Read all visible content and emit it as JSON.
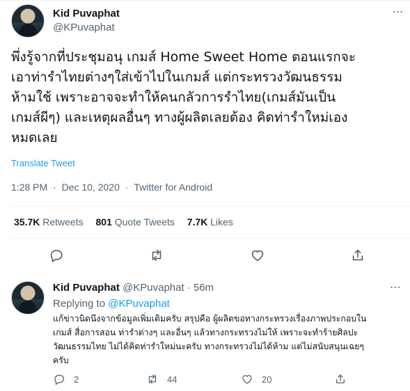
{
  "tweet": {
    "author": {
      "display_name": "Kid Puvaphat",
      "handle": "@KPuvaphat"
    },
    "text_lines": [
      "พึ่งรู้จากที่ประชุมอนุ เกมส์ Home Sweet Home ตอนแรกจะ",
      "เอาท่ารำไทยต่างๆใส่เข้าไปในเกมส์ แต่กระทรวงวัฒนธรรม",
      "ห้ามใช้ เพราะอาจจะทำให้คนกลัวการรำไทย(เกมส์มันเป็น",
      "เกมส์ผีๆ) และเหตุผลอื่นๆ ทางผู้ผลิตเลยต้อง คิดท่ารำใหม่เอง",
      "หมดเลย"
    ],
    "translate_label": "Translate Tweet",
    "time": "1:28 PM",
    "date": "Dec 10, 2020",
    "source": "Twitter for Android",
    "separator": "·",
    "stats": {
      "retweets_count": "35.7K",
      "retweets_label": "Retweets",
      "quotes_count": "801",
      "quotes_label": "Quote Tweets",
      "likes_count": "7.7K",
      "likes_label": "Likes"
    },
    "more_icon": "⋯"
  },
  "reply": {
    "author": {
      "display_name": "Kid Puvaphat",
      "handle": "@KPuvaphat"
    },
    "separator": "·",
    "time_ago": "56m",
    "replying_prefix": "Replying to",
    "replying_to": "@KPuvaphat",
    "text_lines": [
      "แก้ข่าวนิดนึงจากข้อมูลเพิ่มเติมครับ สรุปคือ ผู้ผลิตขอทางกระทรวงเรื่องภาพประกอบใน",
      "เกมส์ สื่อการสอน ท่ารำต่างๆ และอื่นๆ แล้วทางกระทรวงไม่ให้ เพราะจะทำร้ายศิลปะ",
      "วัฒนธรรมไทย ไม่ได้คิดท่ารำใหม่นะครับ ทางกระทรวงไม่ได้ห้าม แต่ไม่สนับสนุนเฉยๆ",
      "ครับ"
    ],
    "reply_count": "2",
    "retweet_count": "44",
    "like_count": "20",
    "more_icon": "⋯"
  },
  "colors": {
    "accent": "#1d9bf0",
    "text": "#0f1419",
    "muted": "#536471",
    "divider": "#eff3f4"
  }
}
